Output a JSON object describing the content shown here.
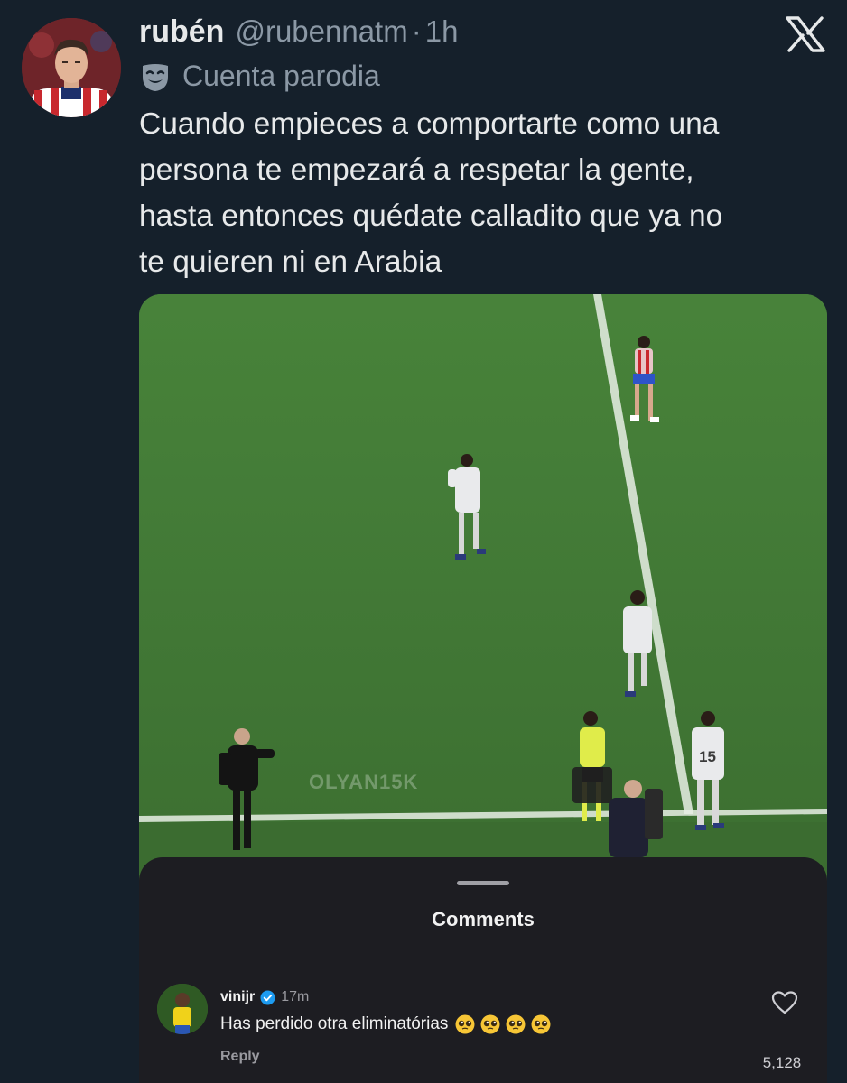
{
  "tweet": {
    "author_name": "rubén",
    "handle": "@rubennatm",
    "separator": "·",
    "time": "1h",
    "parody_label": "Cuenta parodia",
    "text_lines": [
      "Cuando empieces a comportarte como una",
      "persona te empezará a respetar la gente,",
      "hasta entonces quédate calladito que ya no",
      "te quieren ni en Arabia"
    ]
  },
  "media": {
    "watermark": "OLYAN15K",
    "comments_sheet": {
      "title": "Comments",
      "comment": {
        "username": "vinijr",
        "verified": true,
        "time": "17m",
        "text": "Has perdido otra eliminatórias",
        "emoji_count": 4,
        "emoji": "pleading-face",
        "reply_label": "Reply",
        "like_count": "5,128"
      }
    }
  },
  "icons": [
    "x-logo-icon",
    "mask-icon",
    "verified-icon",
    "pleading-face-icon",
    "heart-icon"
  ],
  "colors": {
    "background": "#15202b",
    "text_primary": "#e7e9ea",
    "text_secondary": "#8b98a5",
    "sheet_background": "#1d1d22",
    "verified_blue": "#1d9bf0"
  }
}
